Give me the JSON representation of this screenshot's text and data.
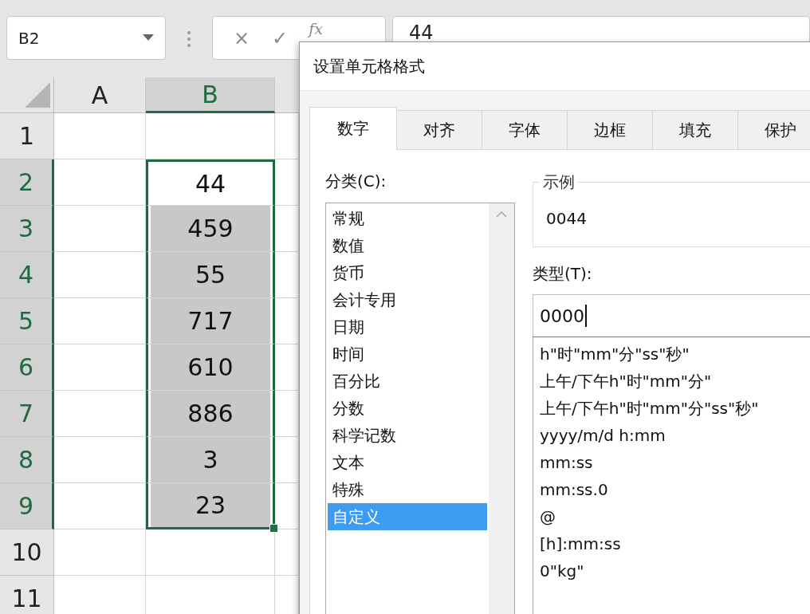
{
  "formula_bar": {
    "name_box": "B2",
    "cancel": "×",
    "confirm": "✓",
    "function": "fx",
    "formula": "44"
  },
  "sheet": {
    "columns": [
      {
        "label": "A",
        "selected": false
      },
      {
        "label": "B",
        "selected": true
      }
    ],
    "rows": [
      {
        "number": "1",
        "selected": false,
        "cells": [
          {
            "selected": false
          },
          {
            "selected": false
          }
        ]
      },
      {
        "number": "2",
        "selected": true,
        "cells": [
          {
            "selected": false
          },
          {
            "value": "44",
            "selected": true,
            "active": true
          }
        ]
      },
      {
        "number": "3",
        "selected": true,
        "cells": [
          {
            "selected": false
          },
          {
            "value": "459",
            "selected": true,
            "active": false
          }
        ]
      },
      {
        "number": "4",
        "selected": true,
        "cells": [
          {
            "selected": false
          },
          {
            "value": "55",
            "selected": true,
            "active": false
          }
        ]
      },
      {
        "number": "5",
        "selected": true,
        "cells": [
          {
            "selected": false
          },
          {
            "value": "717",
            "selected": true,
            "active": false
          }
        ]
      },
      {
        "number": "6",
        "selected": true,
        "cells": [
          {
            "selected": false
          },
          {
            "value": "610",
            "selected": true,
            "active": false
          }
        ]
      },
      {
        "number": "7",
        "selected": true,
        "cells": [
          {
            "selected": false
          },
          {
            "value": "886",
            "selected": true,
            "active": false
          }
        ]
      },
      {
        "number": "8",
        "selected": true,
        "cells": [
          {
            "selected": false
          },
          {
            "value": "3",
            "selected": true,
            "active": false
          }
        ]
      },
      {
        "number": "9",
        "selected": true,
        "cells": [
          {
            "selected": false
          },
          {
            "value": "23",
            "selected": true,
            "active": false
          }
        ]
      },
      {
        "number": "10",
        "selected": false,
        "cells": [
          {
            "selected": false
          },
          {
            "selected": false
          }
        ]
      },
      {
        "number": "11",
        "selected": false,
        "cells": [
          {
            "selected": false
          },
          {
            "selected": false
          }
        ]
      }
    ]
  },
  "dialog": {
    "title": "设置单元格格式",
    "tabs": [
      {
        "label": "数字",
        "selected": true
      },
      {
        "label": "对齐",
        "selected": false
      },
      {
        "label": "字体",
        "selected": false
      },
      {
        "label": "边框",
        "selected": false
      },
      {
        "label": "填充",
        "selected": false
      },
      {
        "label": "保护",
        "selected": false
      }
    ],
    "category_label": "分类(C):",
    "categories": [
      {
        "label": "常规",
        "selected": false
      },
      {
        "label": "数值",
        "selected": false
      },
      {
        "label": "货币",
        "selected": false
      },
      {
        "label": "会计专用",
        "selected": false
      },
      {
        "label": "日期",
        "selected": false
      },
      {
        "label": "时间",
        "selected": false
      },
      {
        "label": "百分比",
        "selected": false
      },
      {
        "label": "分数",
        "selected": false
      },
      {
        "label": "科学记数",
        "selected": false
      },
      {
        "label": "文本",
        "selected": false
      },
      {
        "label": "特殊",
        "selected": false
      },
      {
        "label": "自定义",
        "selected": true
      }
    ],
    "sample_label": "示例",
    "sample_value": "0044",
    "type_label": "类型(T):",
    "type_value": "0000",
    "formats": [
      "h\"时\"mm\"分\"ss\"秒\"",
      "上午/下午h\"时\"mm\"分\"",
      "上午/下午h\"时\"mm\"分\"ss\"秒\"",
      "yyyy/m/d h:mm",
      "mm:ss",
      "mm:ss.0",
      "@",
      "[h]:mm:ss",
      "0\"kg\""
    ]
  }
}
